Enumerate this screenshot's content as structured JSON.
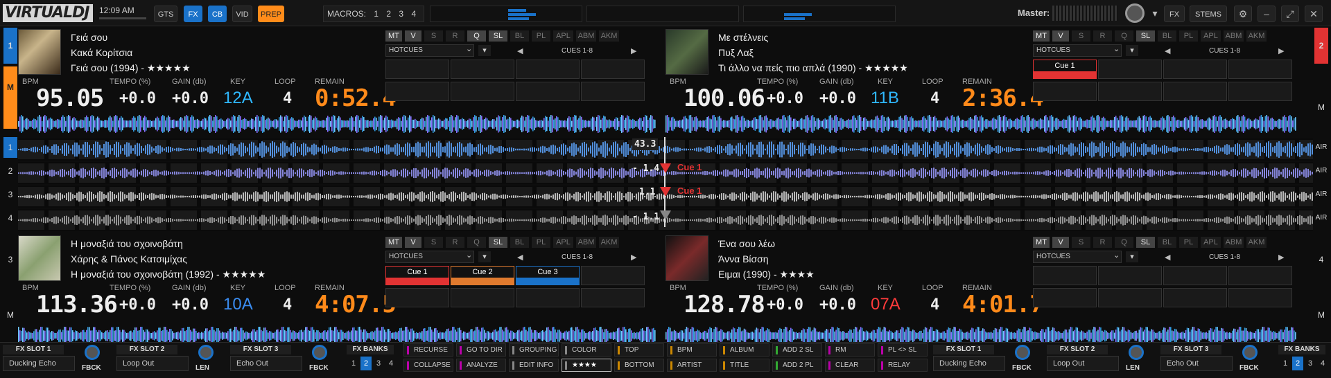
{
  "app": {
    "logo": "VIRTUALDJ",
    "clock": "12:09 AM"
  },
  "topbar": {
    "buttons": [
      "GTS",
      "FX",
      "CB",
      "VID",
      "PREP"
    ],
    "macros_label": "MACROS:",
    "macros": [
      "1",
      "2",
      "3",
      "4"
    ],
    "master_label": "Master:",
    "fx": "FX",
    "stems": "STEMS"
  },
  "colors": {
    "accent": "#1a72c9",
    "prep": "#ff8c1a",
    "cue_red": "#e23333",
    "cue_orange": "#e07a2e",
    "cue_blue": "#1a72c9",
    "key_cyan": "#2fb8ff",
    "key_red": "#ff3b3b",
    "remain": "#ff8a1a"
  },
  "side": {
    "left_top": "1",
    "left_m": "M",
    "lanes": [
      "1",
      "2",
      "3",
      "4"
    ],
    "left_bot": "3",
    "left_bot_m": "M",
    "right_top": "2",
    "right_m": "M",
    "right_bot": "4",
    "right_bot_m": "M",
    "air": [
      "AIR",
      "AIR",
      "AIR",
      "AIR"
    ]
  },
  "pad_buttons": [
    "MT",
    "V",
    "S",
    "R",
    "Q",
    "SL",
    "BL",
    "PL",
    "APL",
    "ABM",
    "AKM"
  ],
  "headers": {
    "bpm": "BPM",
    "tempo": "TEMPO (%)",
    "gain": "GAIN (db)",
    "key": "KEY",
    "loop": "LOOP",
    "remain": "REMAIN",
    "hotcues": "HOTCUES",
    "cues": "CUES 1-8"
  },
  "decks": [
    {
      "title": "Γειά σου",
      "artist": "Κακά Κορίτσια",
      "album": "Γειά σου (1994) - ★★★★★",
      "bpm": "95.05",
      "tempo": "+0.0",
      "gain": "+0.0",
      "key": "12A",
      "loop": "4",
      "remain": "0:52.4",
      "cues": [
        "",
        "",
        "",
        ""
      ],
      "active_pads": [
        "MT",
        "V",
        "Q",
        "SL"
      ]
    },
    {
      "title": "Με στέλνεις",
      "artist": "Πυξ Λαξ",
      "album": "Τι άλλο να πείς πιο απλά (1990) - ★★★★★",
      "bpm": "100.06",
      "tempo": "+0.0",
      "gain": "+0.0",
      "key": "11B",
      "loop": "4",
      "remain": "2:36.4",
      "cues": [
        "Cue 1",
        "",
        "",
        ""
      ],
      "active_pads": [
        "MT",
        "V",
        "SL"
      ]
    },
    {
      "title": "Η μοναξιά του σχοινοβάτη",
      "artist": "Χάρης & Πάνος Κατσιμίχας",
      "album": "Η μοναξιά του σχοινοβάτη (1992) - ★★★★★",
      "bpm": "113.36",
      "tempo": "+0.0",
      "gain": "+0.0",
      "key": "10A",
      "loop": "4",
      "remain": "4:07.5",
      "cues": [
        "Cue 1",
        "Cue 2",
        "Cue 3",
        ""
      ],
      "active_pads": [
        "MT",
        "V",
        "SL"
      ]
    },
    {
      "title": "Ένα σου λέω",
      "artist": "Άννα Βίσση",
      "album": "Ειμαι (1990) - ★★★★",
      "bpm": "128.78",
      "tempo": "+0.0",
      "gain": "+0.0",
      "key": "07A",
      "loop": "4",
      "remain": "4:01.7",
      "cues": [
        "",
        "",
        "",
        ""
      ],
      "active_pads": [
        "MT",
        "V",
        "SL"
      ]
    }
  ],
  "center": {
    "offsets": [
      "43.3",
      "- 1.4",
      "1.1",
      "- 1.1"
    ],
    "cue_markers": [
      "Cue 1",
      "Cue 1"
    ]
  },
  "bottom": {
    "fx_left": [
      {
        "label": "FX SLOT 1",
        "value": "Ducking Echo",
        "knob": "FBCK"
      },
      {
        "label": "FX SLOT 2",
        "value": "Loop Out",
        "knob": "LEN"
      },
      {
        "label": "FX SLOT 3",
        "value": "Echo Out",
        "knob": "FBCK"
      }
    ],
    "fx_right": [
      {
        "label": "FX SLOT 1",
        "value": "Ducking Echo",
        "knob": "FBCK"
      },
      {
        "label": "FX SLOT 2",
        "value": "Loop Out",
        "knob": "LEN"
      },
      {
        "label": "FX SLOT 3",
        "value": "Echo Out",
        "knob": "FBCK"
      }
    ],
    "banks_label": "FX BANKS",
    "banks": [
      "1",
      "2",
      "3",
      "4"
    ],
    "row1": [
      "RECURSE",
      "GO TO DIR",
      "GROUPING",
      "COLOR",
      "TOP",
      "BPM",
      "ALBUM",
      "ADD 2 SL",
      "RM PLAYED",
      "PL <> SL"
    ],
    "row2": [
      "COLLAPSE",
      "ANALYZE",
      "EDIT INFO",
      "★★★★",
      "BOTTOM",
      "ARTIST",
      "TITLE",
      "ADD 2 PL",
      "CLEAR",
      "RELAY"
    ]
  }
}
